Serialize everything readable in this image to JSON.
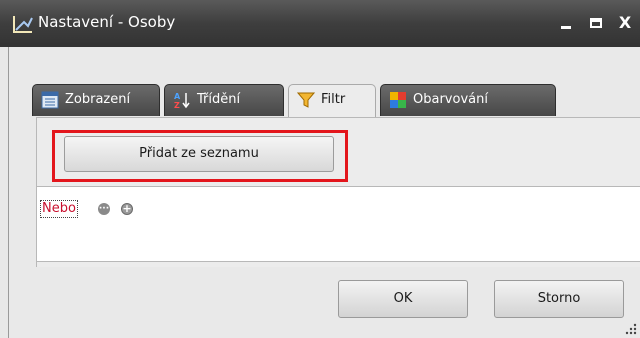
{
  "window": {
    "title": "Nastavení - Osoby",
    "icon": "settings-app-icon",
    "controls": {
      "minimize": "_",
      "maximize": "▭",
      "close": "X"
    }
  },
  "tabs": [
    {
      "label": "Zobrazení",
      "icon": "list-view-icon",
      "active": false
    },
    {
      "label": "Třídění",
      "icon": "sort-az-icon",
      "active": false
    },
    {
      "label": "Filtr",
      "icon": "funnel-icon",
      "active": true
    },
    {
      "label": "Obarvování",
      "icon": "color-palette-icon",
      "active": false
    }
  ],
  "filter": {
    "add_from_list_label": "Přidat ze seznamu",
    "operator_label": "Nebo",
    "more_icon": "ellipsis-circle-icon",
    "add_icon": "plus-circle-icon"
  },
  "footer": {
    "ok_label": "OK",
    "cancel_label": "Storno"
  },
  "colors": {
    "titlebar": "#3e3e3e",
    "highlight": "#e3161c",
    "operator_text": "#c8102e"
  }
}
